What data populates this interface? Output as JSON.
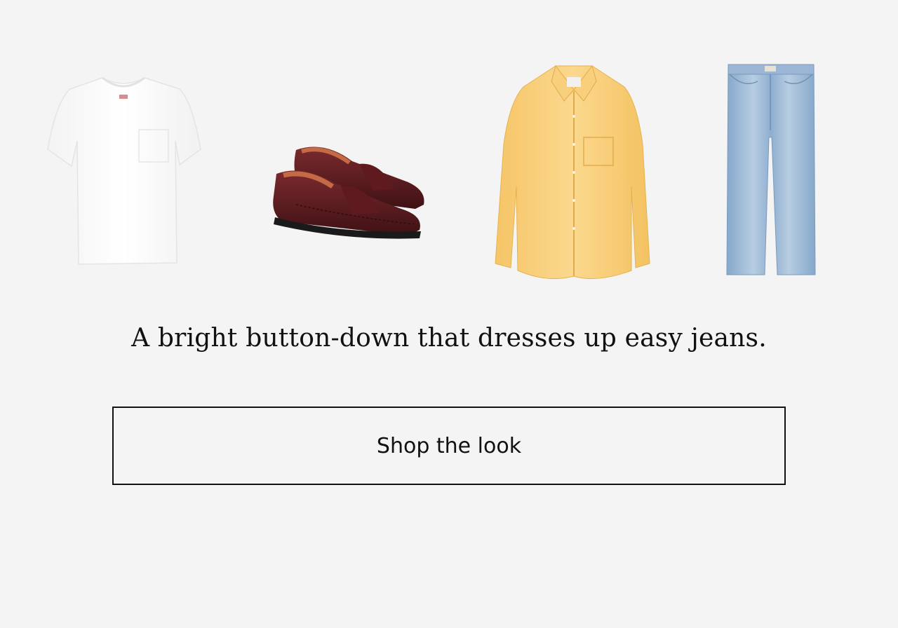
{
  "products": [
    {
      "name": "white-pocket-tee"
    },
    {
      "name": "burgundy-penny-loafers"
    },
    {
      "name": "yellow-oxford-shirt"
    },
    {
      "name": "light-wash-jeans"
    }
  ],
  "headline": "A bright button-down that dresses up easy jeans.",
  "cta": {
    "label": "Shop the look"
  },
  "colors": {
    "background": "#f4f4f4",
    "text": "#111111",
    "shirt": "#f9cf7a",
    "jeans": "#9dbad6",
    "loafers": "#5a1a1f"
  }
}
